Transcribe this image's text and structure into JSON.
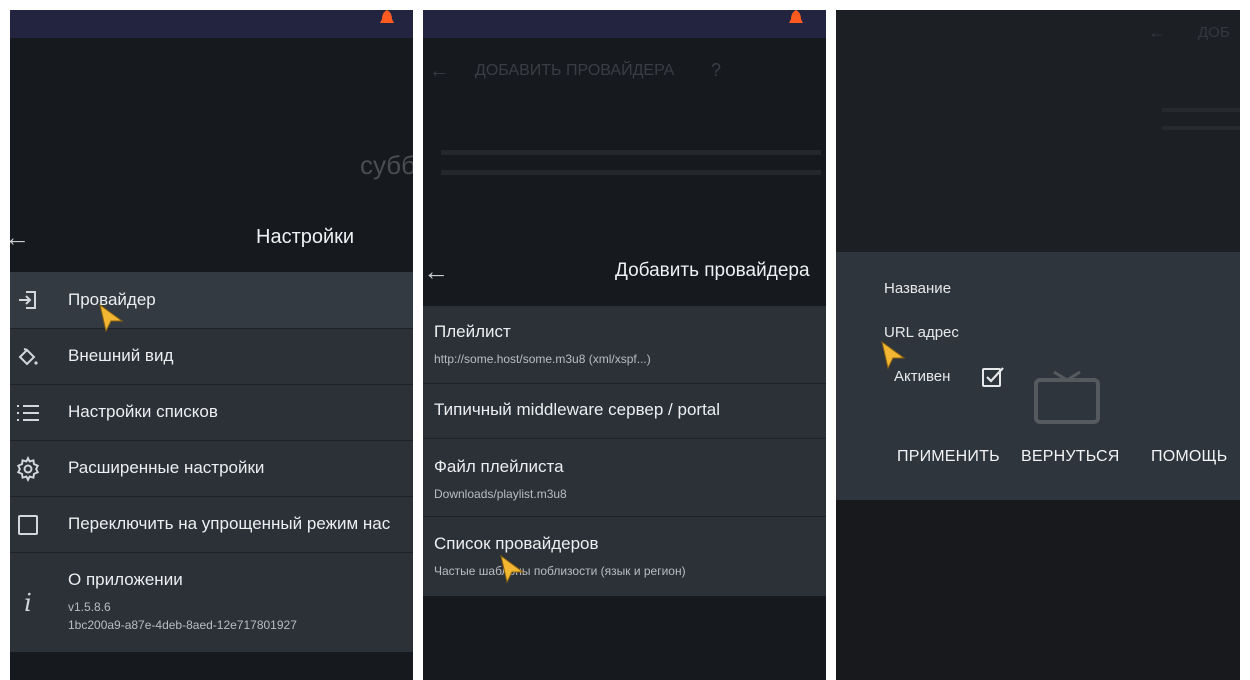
{
  "panel1": {
    "background_text": "субб",
    "header": {
      "title": "Настройки"
    },
    "items": [
      {
        "label": "Провайдер",
        "icon": "login-icon"
      },
      {
        "label": "Внешний вид",
        "icon": "paint-bucket-icon"
      },
      {
        "label": "Настройки списков",
        "icon": "list-icon"
      },
      {
        "label": "Расширенные настройки",
        "icon": "gear-icon"
      },
      {
        "label": "Переключить на упрощенный режим нас",
        "icon": "checkbox-icon"
      },
      {
        "label": "О приложении",
        "icon": "info-icon",
        "version": "v1.5.8.6",
        "build": "1bc200a9-a87e-4deb-8aed-12e717801927"
      }
    ]
  },
  "panel2": {
    "ghost_title": "ДОБАВИТЬ ПРОВАЙДЕРА",
    "ghost_help": "?",
    "header": {
      "title": "Добавить провайдера"
    },
    "items": [
      {
        "label": "Плейлист",
        "sub": "http://some.host/some.m3u8 (xml/xspf...)"
      },
      {
        "label": "Типичный middleware сервер / portal"
      },
      {
        "label": "Файл плейлиста",
        "sub": "Downloads/playlist.m3u8"
      },
      {
        "label": "Список провайдеров",
        "sub": "Частые шаблоны поблизости (язык и регион)"
      }
    ]
  },
  "panel3": {
    "ghost_title": "ДОБ",
    "fields": {
      "name_label": "Название",
      "url_label": "URL адрес",
      "active_label": "Активен",
      "active_checked": true
    },
    "buttons": {
      "apply": "ПРИМЕНИТЬ",
      "back": "ВЕРНУТЬСЯ",
      "help": "ПОМОЩЬ"
    }
  },
  "colors": {
    "statusbar": "#232540",
    "list_bg": "#2c3138",
    "dialog_bg": "#2f353c",
    "bell": "#ff5a1f",
    "cursor": "#f2b632"
  }
}
